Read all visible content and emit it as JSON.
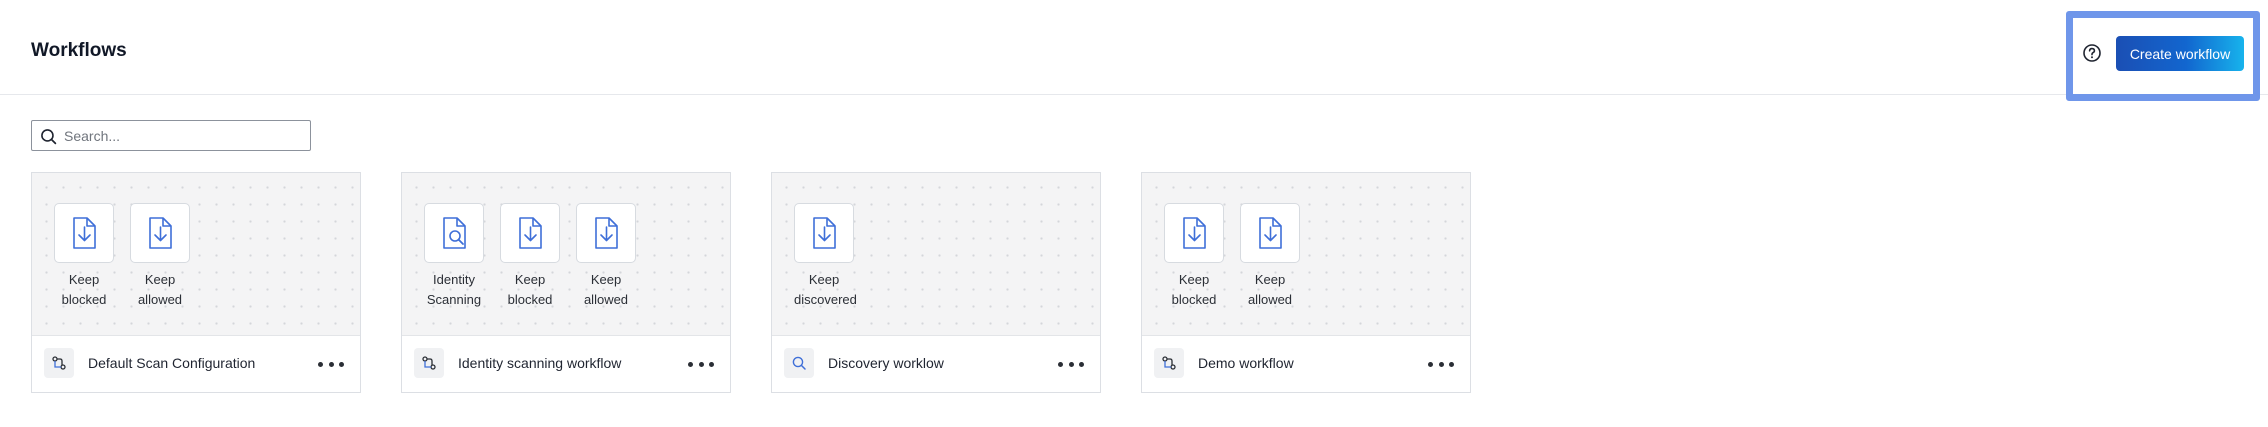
{
  "header": {
    "title": "Workflows",
    "create_label": "Create workflow"
  },
  "search": {
    "placeholder": "Search..."
  },
  "colors": {
    "accent": "#1b4fb4",
    "accent_end": "#17b3ec",
    "highlight": "#6f96ea",
    "icon_blue": "#3f6fd8"
  },
  "workflows": [
    {
      "name": "Default Scan Configuration",
      "icon": "workflow-icon",
      "nodes": [
        {
          "label": "Keep\nblocked",
          "icon": "file-download-icon"
        },
        {
          "label": "Keep\nallowed",
          "icon": "file-download-icon"
        }
      ]
    },
    {
      "name": "Identity scanning workflow",
      "icon": "workflow-icon",
      "nodes": [
        {
          "label": "Identity\nScanning",
          "icon": "file-search-icon"
        },
        {
          "label": "Keep\nblocked",
          "icon": "file-download-icon"
        },
        {
          "label": "Keep\nallowed",
          "icon": "file-download-icon"
        }
      ]
    },
    {
      "name": "Discovery worklow",
      "icon": "discovery-search-icon",
      "nodes": [
        {
          "label": "Keep\ndiscovered",
          "icon": "file-download-icon"
        }
      ]
    },
    {
      "name": "Demo workflow",
      "icon": "workflow-icon",
      "nodes": [
        {
          "label": "Keep\nblocked",
          "icon": "file-download-icon"
        },
        {
          "label": "Keep\nallowed",
          "icon": "file-download-icon"
        }
      ]
    }
  ]
}
